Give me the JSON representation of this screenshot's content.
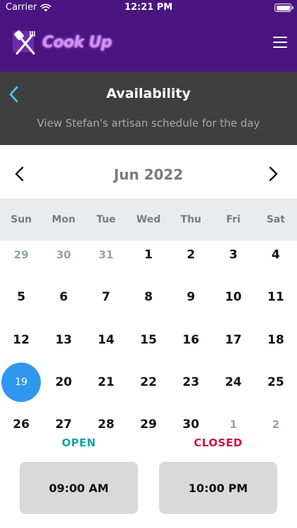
{
  "status_bar": {
    "carrier": "Carrier",
    "time": "12:21 PM"
  },
  "app_bar": {
    "logo_text": "Cook Up",
    "icons": [
      "spatula-fork-logo-icon",
      "hamburger-menu-icon"
    ]
  },
  "header": {
    "title": "Availability",
    "caption": "View Stefan's artisan schedule for the day"
  },
  "calendar": {
    "month_label": "Jun 2022",
    "weekdays": [
      "Sun",
      "Mon",
      "Tue",
      "Wed",
      "Thu",
      "Fri",
      "Sat"
    ],
    "weeks": [
      [
        "29",
        "30",
        "31",
        "1",
        "2",
        "3",
        "4"
      ],
      [
        "5",
        "6",
        "7",
        "8",
        "9",
        "10",
        "11"
      ],
      [
        "12",
        "13",
        "14",
        "15",
        "16",
        "17",
        "18"
      ],
      [
        "19",
        "20",
        "21",
        "22",
        "23",
        "24",
        "25"
      ],
      [
        "26",
        "27",
        "28",
        "29",
        "30",
        "1",
        "2"
      ]
    ],
    "selected_day": "19"
  },
  "hours": {
    "open_label": "OPEN",
    "closed_label": "CLOSED",
    "open_time": "09:00 AM",
    "close_time": "10:00 PM"
  },
  "colors": {
    "brand_purple": "#4a1580",
    "header_gray": "#3f3f3f",
    "selected_blue": "#2f98ee",
    "open_teal": "#13a3a0",
    "closed_red": "#cf1044"
  }
}
